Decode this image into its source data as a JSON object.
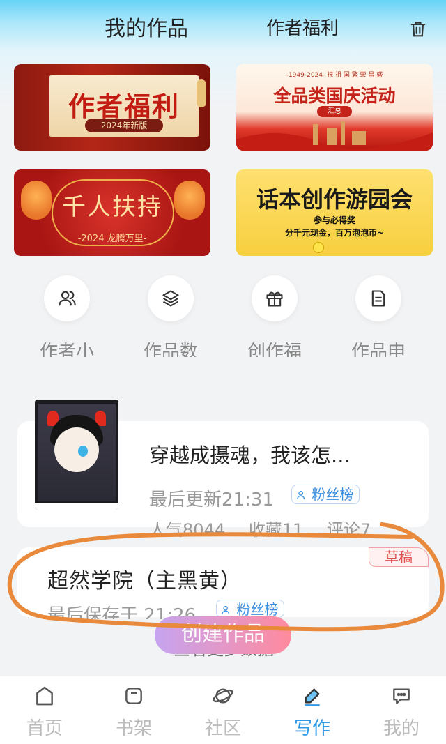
{
  "header": {
    "tab_works": "我的作品",
    "tab_benefits": "作者福利"
  },
  "banners": [
    {
      "title": "作者福利",
      "subtitle": "2024年新版"
    },
    {
      "top_text": "-1949-2024- 祝 祖 国 繁 荣 昌 盛",
      "title": "全品类国庆活动",
      "tag": "汇总"
    },
    {
      "title": "千人扶持",
      "subtitle": "-2024 龙腾万里-"
    },
    {
      "title": "话本创作游园会",
      "line1": "参与必得奖",
      "line2": "分千元现金，百万泡泡币~"
    }
  ],
  "quick_actions": [
    {
      "label": "作者小",
      "icon": "users-icon"
    },
    {
      "label": "作品数",
      "icon": "layers-icon"
    },
    {
      "label": "创作福",
      "icon": "gift-icon"
    },
    {
      "label": "作品申",
      "icon": "document-icon"
    }
  ],
  "works": [
    {
      "title": "穿越成摄魂，我该怎...",
      "updated": "最后更新21:31",
      "badge": "粉丝榜",
      "stats": {
        "popularity": "人气8044",
        "favorites": "收藏11",
        "comments": "评论7"
      }
    }
  ],
  "draft": {
    "tag": "草稿",
    "title": "超然学院（主黑黄）",
    "saved": "最后保存于 21:26",
    "badge": "粉丝榜"
  },
  "create_button": "创建作品",
  "more_data": "查看更多数据",
  "nav": [
    {
      "label": "首页",
      "icon": "home-icon",
      "active": false
    },
    {
      "label": "书架",
      "icon": "bookshelf-icon",
      "active": false
    },
    {
      "label": "社区",
      "icon": "planet-icon",
      "active": false
    },
    {
      "label": "写作",
      "icon": "pen-icon",
      "active": true
    },
    {
      "label": "我的",
      "icon": "chat-icon",
      "active": false
    }
  ],
  "colors": {
    "accent": "#2f9be8",
    "annotation": "#e8893c",
    "draft": "#e05050"
  }
}
